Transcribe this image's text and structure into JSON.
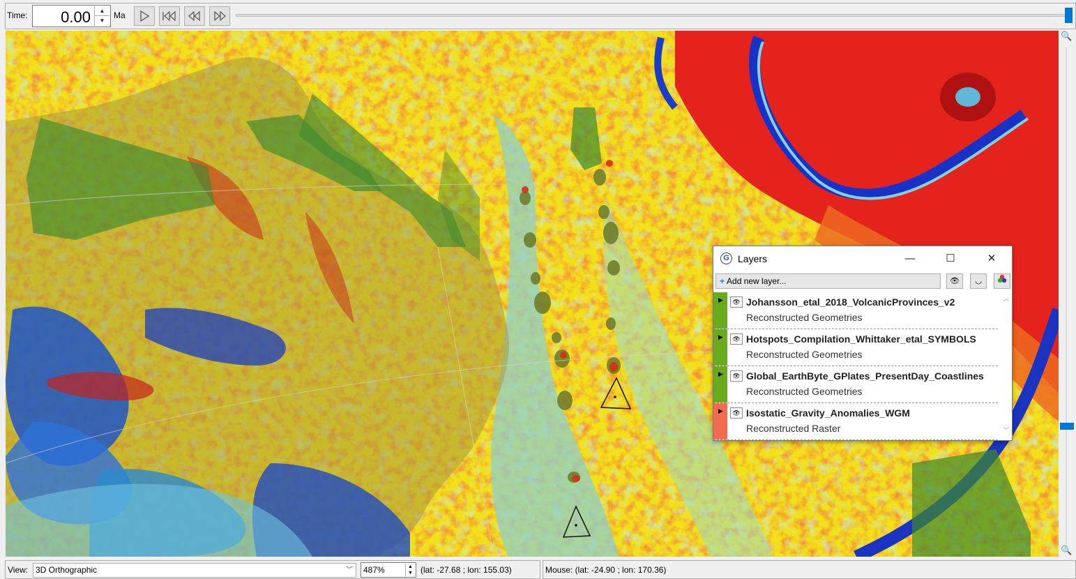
{
  "toolbar": {
    "time_label": "Time:",
    "time_value": "0.00",
    "time_unit": "Ma",
    "play_icon": "play-icon",
    "rewind_start_icon": "skip-to-start-icon",
    "step_back_icon": "step-back-icon",
    "step_forward_icon": "step-forward-icon"
  },
  "map": {
    "description_colors": {
      "high": "#d7191c",
      "mid": "#f5e611",
      "low": "#2b6fd6"
    },
    "hotspot_marker_icon": "triangle-icon"
  },
  "layers_window": {
    "title": "Layers",
    "add_layer_label": "Add new layer...",
    "layers": [
      {
        "name": "Johansson_etal_2018_VolcanicProvinces_v2",
        "type": "Reconstructed Geometries",
        "color": "#6aaa1f"
      },
      {
        "name": "Hotspots_Compilation_Whittaker_etal_SYMBOLS",
        "type": "Reconstructed Geometries",
        "color": "#6aaa1f"
      },
      {
        "name": "Global_EarthByte_GPlates_PresentDay_Coastlines",
        "type": "Reconstructed Geometries",
        "color": "#6aaa1f"
      },
      {
        "name": "Isostatic_Gravity_Anomalies_WGM",
        "type": "Reconstructed Raster",
        "color": "#f26b4f"
      }
    ]
  },
  "statusbar": {
    "view_label": "View:",
    "view_value": "3D Orthographic",
    "zoom_value": "487%",
    "camera_latlon": "(lat: -27.68 ; lon: 155.03)",
    "mouse_latlon": "Mouse: (lat: -24.90 ; lon: 170.36)"
  }
}
